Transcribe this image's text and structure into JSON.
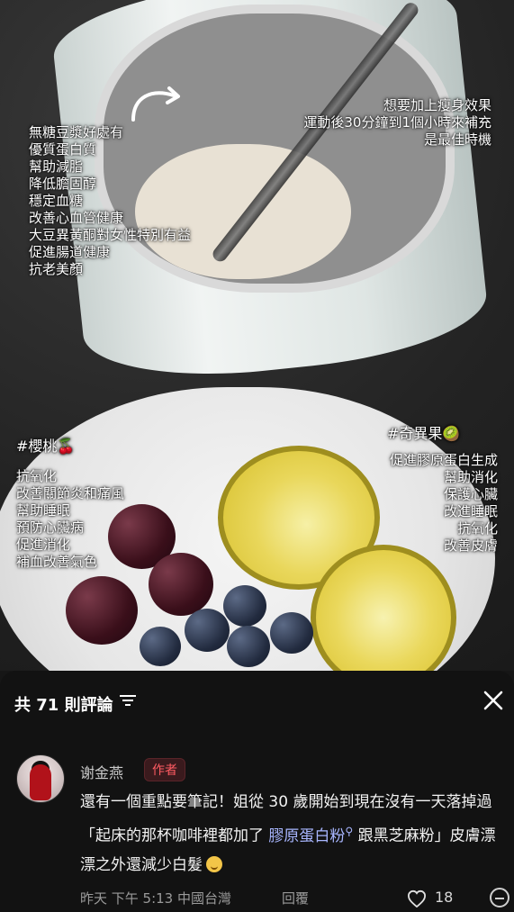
{
  "photo": {
    "tag_left": "#櫻桃🍒",
    "tag_right": "#奇異果🥝",
    "text_left_top": "無糖豆漿好處有\n優質蛋白質\n幫助減脂\n降低膽固醇\n穩定血糖\n改善心血管健康\n大豆異黃酮對女性特別有益\n促進腸道健康\n抗老美顏",
    "text_right_top": "想要加上瘦身效果\n運動後30分鐘到1個小時來補充\n是最佳時機",
    "text_cherry": "抗氧化\n改善關節炎和痛風\n幫助睡眠\n預防心臟病\n促進消化\n補血改善氣色",
    "text_kiwi": "促進膠原蛋白生成\n幫助消化\n保護心臟\n改進睡眠\n抗氧化\n改善皮膚"
  },
  "comments": {
    "header": "共 71 則評論",
    "user_name": "谢金燕",
    "badge": "作者",
    "text_part1": "還有一個重點要筆記！姐從 30 歲開始到現在沒有一天落掉過「起床的那杯咖啡裡都加了 ",
    "link_text": "膠原蛋白粉",
    "text_part2": " 跟黑芝麻粉」皮膚漂漂之外還減少白髮",
    "meta": "昨天 下午 5:13 中國台灣",
    "reply": "回覆",
    "likes": "18"
  },
  "icons": {
    "filter": "filter-icon",
    "close": "close-icon",
    "heart": "heart-icon",
    "more": "more-icon",
    "search": "search-icon",
    "arrow": "curved-arrow-icon"
  }
}
